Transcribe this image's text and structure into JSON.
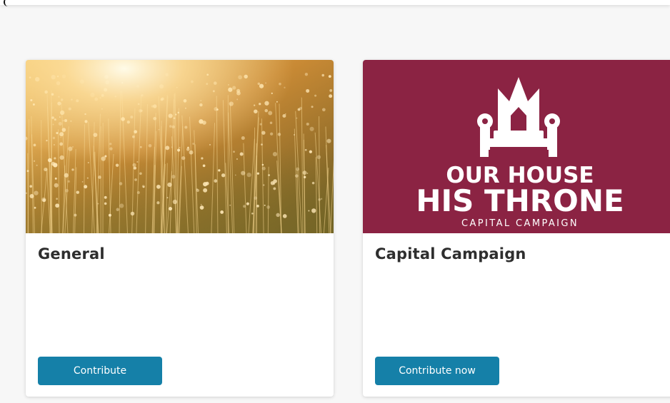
{
  "cards": [
    {
      "title": "General",
      "button_label": "Contribute",
      "image": "golden-grass-sunset-photo"
    },
    {
      "title": "Capital Campaign",
      "button_label": "Contribute now",
      "image": "campaign-logo",
      "logo": {
        "line1": "OUR HOUSE",
        "line2": "HIS THRONE",
        "line3": "CAPITAL CAMPAIGN",
        "icon": "throne-crown-icon"
      }
    }
  ],
  "colors": {
    "button": "#1580a8",
    "campaign_bg": "#8b2343",
    "page_bg": "#f7f7f7"
  }
}
